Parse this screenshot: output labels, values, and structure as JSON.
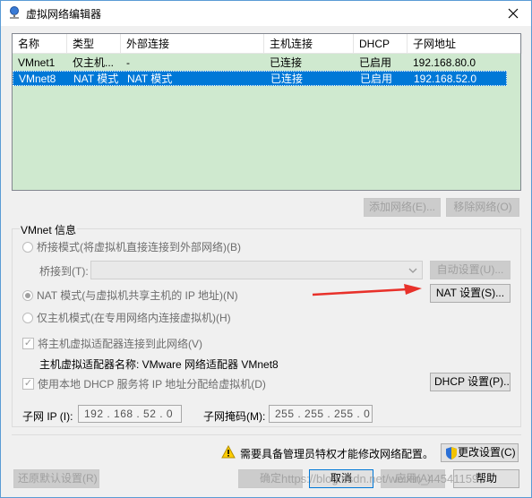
{
  "window": {
    "title": "虚拟网络编辑器"
  },
  "list": {
    "headers": [
      "名称",
      "类型",
      "外部连接",
      "主机连接",
      "DHCP",
      "子网地址"
    ],
    "rows": [
      {
        "name": "VMnet1",
        "type": "仅主机...",
        "external": "-",
        "host": "已连接",
        "dhcp": "已启用",
        "subnet": "192.168.80.0",
        "selected": false
      },
      {
        "name": "VMnet8",
        "type": "NAT 模式",
        "external": "NAT 模式",
        "host": "已连接",
        "dhcp": "已启用",
        "subnet": "192.168.52.0",
        "selected": true
      }
    ]
  },
  "buttons": {
    "add_network": "添加网络(E)...",
    "remove_network": "移除网络(O)",
    "auto_settings": "自动设置(U)...",
    "nat_settings": "NAT 设置(S)...",
    "dhcp_settings": "DHCP 设置(P)...",
    "change_settings": "更改设置(C)",
    "restore_defaults": "还原默认设置(R)",
    "ok": "确定",
    "cancel": "取消",
    "apply": "应用(A)",
    "help": "帮助"
  },
  "vmnet_info": {
    "label": "VMnet 信息",
    "bridged": "桥接模式(将虚拟机直接连接到外部网络)(B)",
    "bridged_to": "桥接到(T):",
    "bridged_to_value": "",
    "nat": "NAT 模式(与虚拟机共享主机的 IP 地址)(N)",
    "host_only": "仅主机模式(在专用网络内连接虚拟机)(H)",
    "connect_adapter": "将主机虚拟适配器连接到此网络(V)",
    "adapter_name": "主机虚拟适配器名称: VMware 网络适配器 VMnet8",
    "use_dhcp": "使用本地 DHCP 服务将 IP 地址分配给虚拟机(D)",
    "selected_mode": "nat",
    "connect_adapter_checked": true,
    "use_dhcp_checked": true
  },
  "subnet": {
    "ip_label": "子网 IP (I):",
    "ip_value": "192 . 168 . 52 . 0",
    "mask_label": "子网掩码(M):",
    "mask_value": "255 . 255 . 255 . 0"
  },
  "admin_notice": "需要具备管理员特权才能修改网络配置。",
  "watermark": "https://blog.csdn.net/weixin_44541159",
  "colors": {
    "list_bg": "#cfe9cf",
    "selection": "#0078d7",
    "arrow": "#e8312a"
  }
}
